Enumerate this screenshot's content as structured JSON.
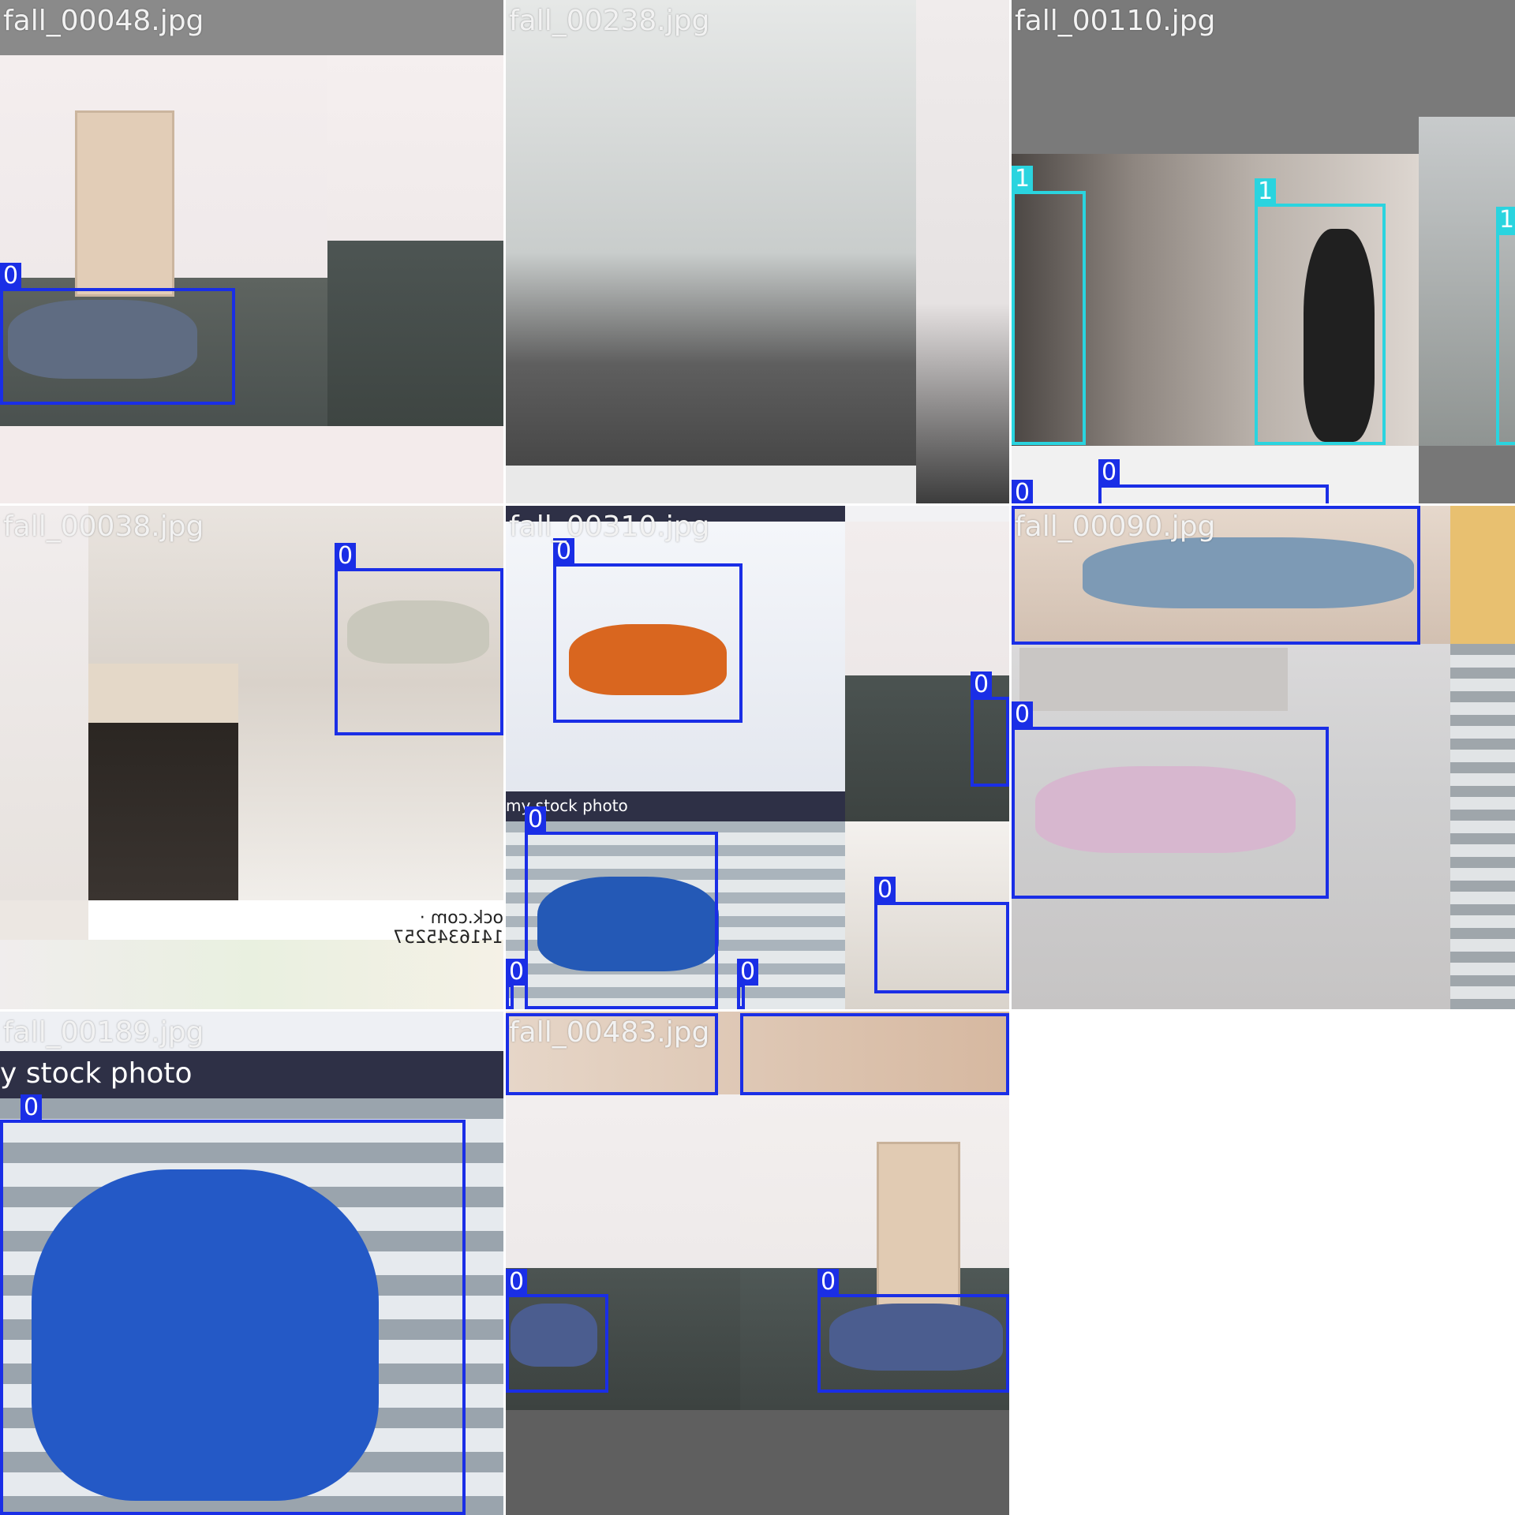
{
  "tiles": [
    {
      "file": "fall_00048.jpg",
      "labels": [
        "0"
      ]
    },
    {
      "file": "fall_00238.jpg",
      "labels": []
    },
    {
      "file": "fall_00110.jpg",
      "labels": [
        "1",
        "1",
        "1",
        "0",
        "0"
      ]
    },
    {
      "file": "fall_00038.jpg",
      "labels": [
        "0"
      ],
      "watermark": "ock.com · 1416345257"
    },
    {
      "file": "fall_00310.jpg",
      "labels": [
        "0",
        "0",
        "0",
        "0",
        "0",
        "0"
      ],
      "watermark": "my stock photo"
    },
    {
      "file": "fall_00090.jpg",
      "labels": [
        "0"
      ]
    },
    {
      "file": "fall_00189.jpg",
      "labels": [
        "0"
      ],
      "watermark": "y stock photo"
    },
    {
      "file": "fall_00483.jpg",
      "labels": [
        "0",
        "0"
      ]
    }
  ],
  "classes": {
    "0": "#1a2ee6",
    "1": "#2ad4df"
  }
}
